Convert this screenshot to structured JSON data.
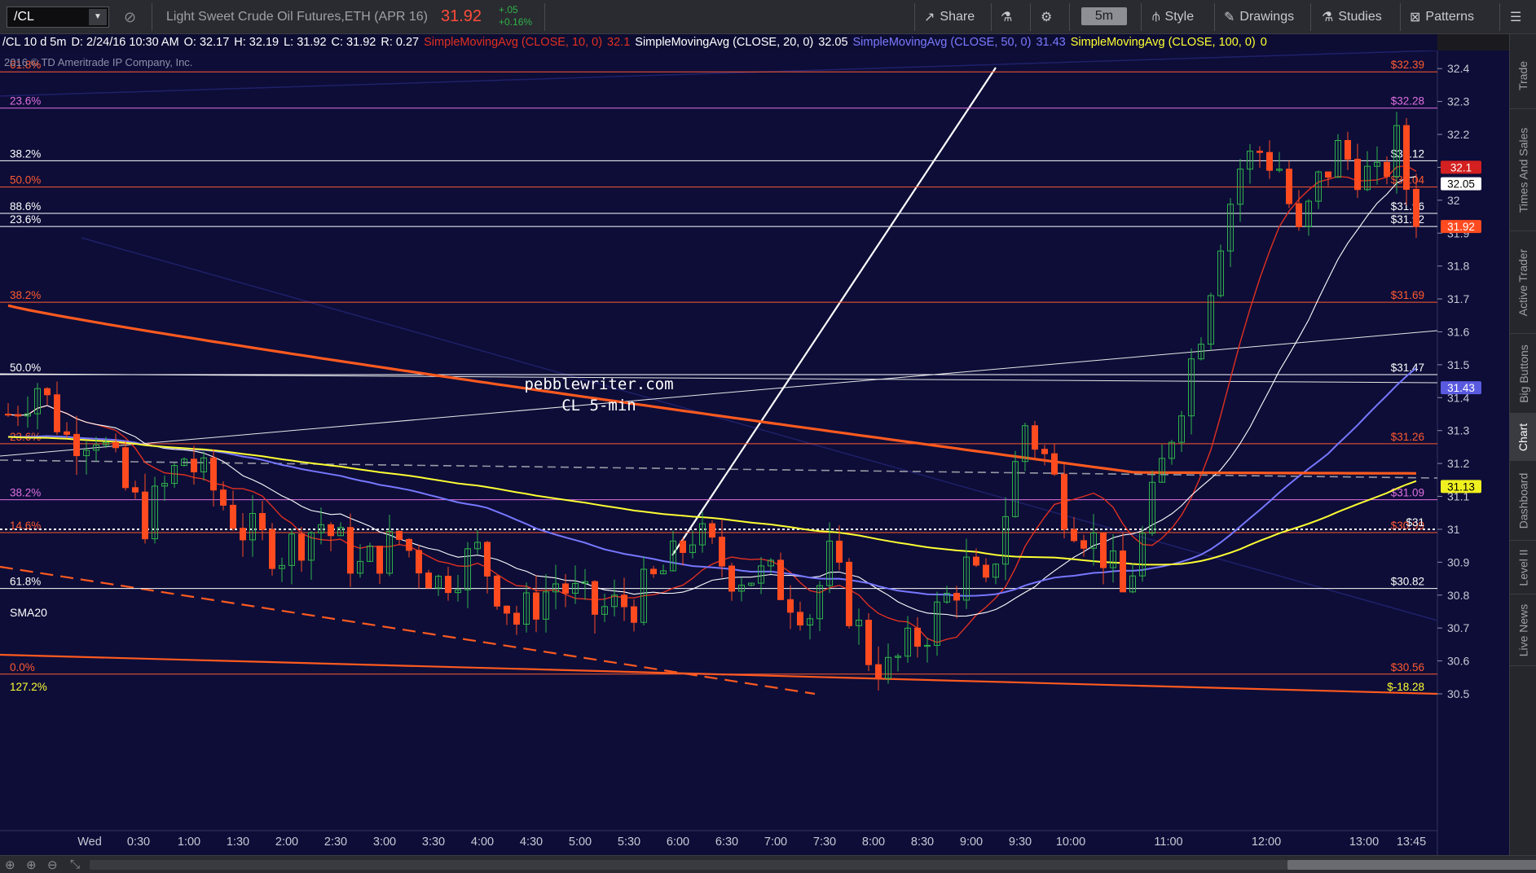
{
  "toolbar": {
    "symbol": "/CL",
    "instrument": "Light Sweet Crude Oil Futures,ETH (APR 16)",
    "last_price": "31.92",
    "change": "+.05",
    "change_pct": "+0.16%",
    "share_label": "Share",
    "timeframe": "5m",
    "style_label": "Style",
    "drawings_label": "Drawings",
    "studies_label": "Studies",
    "patterns_label": "Patterns"
  },
  "header": {
    "symbol_period": "/CL 10 d 5m",
    "date": "D: 2/24/16 10:30 AM",
    "open": "O: 32.17",
    "high": "H: 32.19",
    "low": "L: 31.92",
    "close": "C: 31.92",
    "range": "R: 0.27",
    "sma10_label": "SimpleMovingAvg (CLOSE, 10, 0)",
    "sma10_value": "32.1",
    "sma20_label": "SimpleMovingAvg (CLOSE, 20, 0)",
    "sma20_value": "32.05",
    "sma50_label": "SimpleMovingAvg (CLOSE, 50, 0)",
    "sma50_value": "31.43",
    "sma100_label": "SimpleMovingAvg (CLOSE, 100, 0)",
    "sma100_value": "0"
  },
  "copyright": "2016 © TD Ameritrade IP Company, Inc.",
  "watermark": [
    "pebblewriter.com",
    "CL 5-min"
  ],
  "sma20_tag": "SMA20",
  "colors": {
    "background": "#0d0d38",
    "up": "#2fb34a",
    "down": "#ff4b1f",
    "sma10": "#e03020",
    "sma20": "#ffffff",
    "sma50": "#7777ff",
    "sma100": "#ffff33",
    "sma200": "#ff5a1f",
    "fib_red": "#ff5a30",
    "fib_magenta": "#e070e0",
    "fib_white": "#ffffff"
  },
  "chart_data": {
    "type": "candlestick",
    "title": "Light Sweet Crude Oil Futures,ETH (APR 16)",
    "ylim": [
      30.5,
      32.45
    ],
    "y_ticks": [
      30.5,
      30.6,
      30.7,
      30.8,
      30.9,
      31,
      31.1,
      31.2,
      31.3,
      31.4,
      31.5,
      31.6,
      31.7,
      31.8,
      31.9,
      32,
      32.1,
      32.2,
      32.3,
      32.4
    ],
    "x_ticks": [
      "Wed",
      "0:30",
      "1:00",
      "1:30",
      "2:00",
      "2:30",
      "3:00",
      "3:30",
      "4:00",
      "4:30",
      "5:00",
      "5:30",
      "6:00",
      "6:30",
      "7:00",
      "7:30",
      "8:00",
      "8:30",
      "9:00",
      "9:30",
      "10:00",
      "11:00",
      "12:00",
      "13:00",
      "13:45"
    ],
    "price_path": [
      [
        0,
        31.35
      ],
      [
        3,
        31.44
      ],
      [
        6,
        31.28
      ],
      [
        9,
        31.3
      ],
      [
        12,
        31.12
      ],
      [
        14,
        31.03
      ],
      [
        18,
        31.22
      ],
      [
        21,
        31.12
      ],
      [
        24,
        31.0
      ],
      [
        28,
        30.93
      ],
      [
        32,
        31.02
      ],
      [
        36,
        30.88
      ],
      [
        40,
        30.97
      ],
      [
        44,
        30.84
      ],
      [
        48,
        30.93
      ],
      [
        52,
        30.72
      ],
      [
        56,
        30.84
      ],
      [
        60,
        30.75
      ],
      [
        64,
        30.78
      ],
      [
        68,
        30.9
      ],
      [
        70,
        30.99
      ],
      [
        74,
        30.87
      ],
      [
        78,
        30.85
      ],
      [
        82,
        30.75
      ],
      [
        84,
        30.91
      ],
      [
        88,
        30.62
      ],
      [
        90,
        30.57
      ],
      [
        94,
        30.7
      ],
      [
        98,
        30.88
      ],
      [
        100,
        30.8
      ],
      [
        104,
        31.32
      ],
      [
        106,
        31.22
      ],
      [
        108,
        31.07
      ],
      [
        112,
        30.93
      ],
      [
        114,
        30.8
      ],
      [
        116,
        30.97
      ],
      [
        119,
        31.3
      ],
      [
        122,
        31.62
      ],
      [
        124,
        31.9
      ],
      [
        126,
        32.1
      ],
      [
        128,
        32.15
      ],
      [
        130,
        32.1
      ],
      [
        132,
        31.88
      ],
      [
        134,
        32.05
      ],
      [
        136,
        32.15
      ],
      [
        138,
        32.1
      ],
      [
        140,
        32.05
      ],
      [
        142,
        32.17
      ],
      [
        144,
        31.92
      ]
    ],
    "sma": [
      {
        "name": "SimpleMovingAvg (CLOSE, 10, 0)",
        "last": 32.1
      },
      {
        "name": "SimpleMovingAvg (CLOSE, 20, 0)",
        "last": 32.05
      },
      {
        "name": "SimpleMovingAvg (CLOSE, 50, 0)",
        "last": 31.43
      },
      {
        "name": "SimpleMovingAvg (CLOSE, 100, 0)",
        "last": 31.13
      }
    ],
    "right_tags": [
      {
        "label": "32.1",
        "value": 32.1,
        "color": "#d42020"
      },
      {
        "label": "32.05",
        "value": 32.05,
        "color": "#ffffff"
      },
      {
        "label": "31.92",
        "value": 31.92,
        "color": "#ff4b1f"
      },
      {
        "label": "31.43",
        "value": 31.43,
        "color": "#5a5ae0"
      },
      {
        "label": "31.13",
        "value": 31.13,
        "color": "#f0f020"
      }
    ],
    "fib_levels": [
      {
        "pct": "61.8%",
        "price": "$32.39",
        "value": 32.39,
        "color": "#ff5a30"
      },
      {
        "pct": "23.6%",
        "price": "$32.28",
        "value": 32.28,
        "color": "#e070e0"
      },
      {
        "pct": "38.2%",
        "price": "$32.12",
        "value": 32.12,
        "color": "#ffffff"
      },
      {
        "pct": "50.0%",
        "price": "$32.04",
        "value": 32.04,
        "color": "#ff5a30"
      },
      {
        "pct": "88.6%",
        "price": "$31.96",
        "value": 31.96,
        "color": "#ffffff"
      },
      {
        "pct": "23.6%",
        "price": "$31.92",
        "value": 31.92,
        "color": "#ffffff"
      },
      {
        "pct": "38.2%",
        "price": "$31.69",
        "value": 31.69,
        "color": "#ff5a30"
      },
      {
        "pct": "50.0%",
        "price": "$31.47",
        "value": 31.47,
        "color": "#ffffff"
      },
      {
        "pct": "23.6%",
        "price": "$31.26",
        "value": 31.26,
        "color": "#ff5a30"
      },
      {
        "pct": "38.2%",
        "price": "$31.09",
        "value": 31.09,
        "color": "#e070e0"
      },
      {
        "pct": "14.6%",
        "price": "$30.99",
        "value": 30.99,
        "color": "#ff5a30"
      },
      {
        "pct": "61.8%",
        "price": "$30.82",
        "value": 30.82,
        "color": "#ffffff"
      },
      {
        "pct": "0.0%",
        "price": "$30.56",
        "value": 30.56,
        "color": "#ff5a30"
      },
      {
        "pct": "127.2%",
        "price": "$-18.28",
        "value": 30.5,
        "color": "#ffff33"
      }
    ],
    "dotted_level": {
      "label": "$31",
      "value": 31.0
    }
  },
  "right_panel_tabs": [
    "Trade",
    "Times And Sales",
    "Active Trader",
    "Big Buttons",
    "Chart",
    "Dashboard",
    "Level II",
    "Live News"
  ]
}
